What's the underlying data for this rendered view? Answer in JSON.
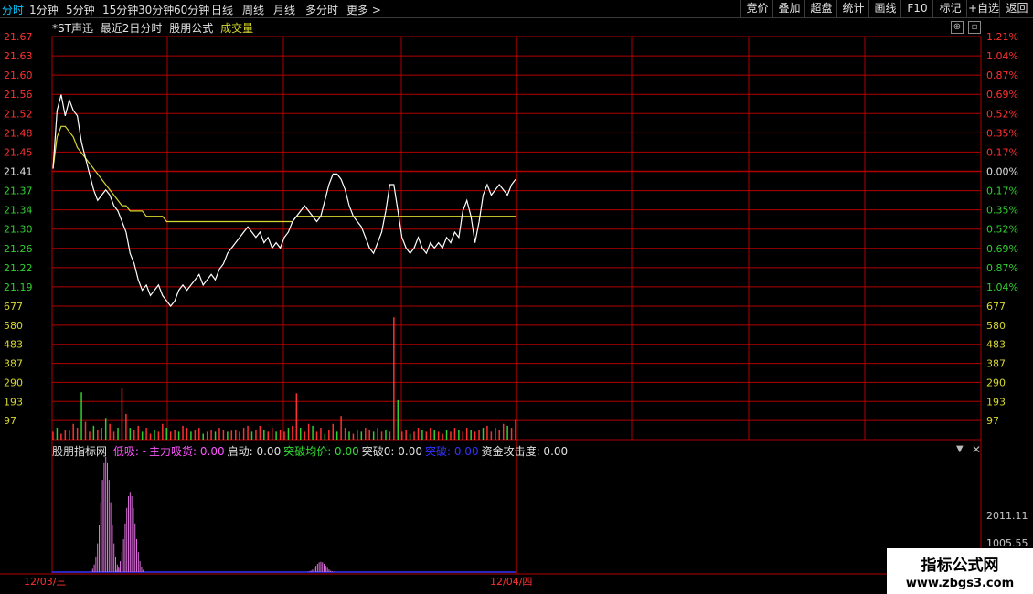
{
  "toolbar": {
    "tabs": [
      "分时",
      "1分钟",
      "5分钟",
      "15分钟",
      "30分钟",
      "60分钟",
      "日线",
      "周线",
      "月线",
      "多分时",
      "更多 >"
    ],
    "active_tab": "分时",
    "right_buttons": [
      "竞价",
      "叠加",
      "超盘",
      "统计",
      "画线",
      "F10",
      "标记",
      "+自选",
      "返回"
    ]
  },
  "info_bar": {
    "stock": "*ST声迅",
    "mode": "最近2日分时",
    "formula": "股朋公式",
    "volume_label": "成交量"
  },
  "price_axis": {
    "left": [
      "21.67",
      "21.63",
      "21.60",
      "21.56",
      "21.52",
      "21.48",
      "21.45",
      "21.41",
      "21.37",
      "21.34",
      "21.30",
      "21.26",
      "21.22",
      "21.19"
    ],
    "right": [
      "1.21%",
      "1.04%",
      "0.87%",
      "0.69%",
      "0.52%",
      "0.35%",
      "0.17%",
      "0.00%",
      "0.17%",
      "0.35%",
      "0.52%",
      "0.69%",
      "0.87%",
      "1.04%"
    ]
  },
  "volume_axis": {
    "left": [
      "677",
      "580",
      "483",
      "387",
      "290",
      "193",
      "97"
    ],
    "right": [
      "677",
      "580",
      "483",
      "387",
      "290",
      "193",
      "97"
    ]
  },
  "indicator_bar": {
    "name": "股朋指标网",
    "items": [
      {
        "text": "低吸: -",
        "color": "#ff55ff"
      },
      {
        "text": "主力吸货: 0.00",
        "color": "#ff55ff"
      },
      {
        "text": "启动: 0.00",
        "color": "#e0e0e0"
      },
      {
        "text": "突破均价: 0.00",
        "color": "#33dd33"
      },
      {
        "text": "突破0: 0.00",
        "color": "#e0e0e0"
      },
      {
        "text": "突破: 0.00",
        "color": "#3333ff"
      },
      {
        "text": "资金攻击度: 0.00",
        "color": "#e0e0e0"
      }
    ]
  },
  "indicator_axis": [
    "2011.11",
    "1005.55"
  ],
  "dates": [
    "12/03/三",
    "12/04/四"
  ],
  "watermark": {
    "line1": "指标公式网",
    "line2": "www.zbgs3.com"
  },
  "colors": {
    "grid": "#b00000",
    "price_line": "#ffffff",
    "avg_line": "#d8d830",
    "up": "#ff3030",
    "down": "#30d030",
    "flat": "#c8c8c8",
    "indicator": "#e070e0"
  },
  "chart_data": {
    "type": "line",
    "price_series": {
      "prev_close": 21.41,
      "ylim": [
        21.17,
        21.68
      ],
      "price": [
        21.43,
        21.54,
        21.57,
        21.53,
        21.56,
        21.54,
        21.53,
        21.48,
        21.45,
        21.42,
        21.39,
        21.37,
        21.38,
        21.39,
        21.38,
        21.36,
        21.35,
        21.33,
        21.31,
        21.27,
        21.25,
        21.22,
        21.2,
        21.21,
        21.19,
        21.2,
        21.21,
        21.19,
        21.18,
        21.17,
        21.18,
        21.2,
        21.21,
        21.2,
        21.21,
        21.22,
        21.23,
        21.21,
        21.22,
        21.23,
        21.22,
        21.24,
        21.25,
        21.27,
        21.28,
        21.29,
        21.3,
        21.31,
        21.32,
        21.31,
        21.3,
        21.31,
        21.29,
        21.3,
        21.28,
        21.29,
        21.28,
        21.3,
        21.31,
        21.33,
        21.34,
        21.35,
        21.36,
        21.35,
        21.34,
        21.33,
        21.34,
        21.37,
        21.4,
        21.42,
        21.42,
        21.41,
        21.39,
        21.36,
        21.34,
        21.33,
        21.32,
        21.3,
        21.28,
        21.27,
        21.29,
        21.31,
        21.35,
        21.4,
        21.4,
        21.35,
        21.3,
        21.28,
        21.27,
        21.28,
        21.3,
        21.28,
        21.27,
        21.29,
        21.28,
        21.29,
        21.28,
        21.3,
        21.29,
        21.31,
        21.3,
        21.35,
        21.37,
        21.34,
        21.29,
        21.33,
        21.38,
        21.4,
        21.38,
        21.39,
        21.4,
        21.39,
        21.38,
        21.4,
        21.41
      ],
      "avg": [
        21.43,
        21.49,
        21.51,
        21.51,
        21.5,
        21.49,
        21.47,
        21.46,
        21.45,
        21.44,
        21.43,
        21.42,
        21.41,
        21.4,
        21.39,
        21.38,
        21.37,
        21.36,
        21.36,
        21.35,
        21.35,
        21.35,
        21.35,
        21.34,
        21.34,
        21.34,
        21.34,
        21.34,
        21.33,
        21.33,
        21.33,
        21.33,
        21.33,
        21.33,
        21.33,
        21.33,
        21.33,
        21.33,
        21.33,
        21.33,
        21.33,
        21.33,
        21.33,
        21.33,
        21.33,
        21.33,
        21.33,
        21.33,
        21.33,
        21.33,
        21.33,
        21.33,
        21.33,
        21.33,
        21.33,
        21.33,
        21.33,
        21.33,
        21.33,
        21.33,
        21.34,
        21.34,
        21.34,
        21.34,
        21.34,
        21.34,
        21.34,
        21.34,
        21.34,
        21.34,
        21.34,
        21.34,
        21.34,
        21.34,
        21.34,
        21.34,
        21.34,
        21.34,
        21.34,
        21.34,
        21.34,
        21.34,
        21.34,
        21.34,
        21.34,
        21.34,
        21.34,
        21.34,
        21.34,
        21.34,
        21.34,
        21.34,
        21.34,
        21.34,
        21.34,
        21.34,
        21.34,
        21.34,
        21.34,
        21.34,
        21.34,
        21.34,
        21.34,
        21.34,
        21.34,
        21.34,
        21.34,
        21.34,
        21.34,
        21.34,
        21.34,
        21.34,
        21.34,
        21.34,
        21.34
      ]
    },
    "volume_series": {
      "ylim": [
        0,
        677
      ],
      "values": [
        40,
        60,
        30,
        50,
        45,
        80,
        60,
        240,
        90,
        40,
        70,
        50,
        60,
        110,
        80,
        40,
        60,
        260,
        130,
        60,
        50,
        70,
        40,
        60,
        30,
        50,
        40,
        80,
        60,
        40,
        50,
        40,
        70,
        60,
        40,
        50,
        60,
        30,
        40,
        50,
        40,
        60,
        50,
        40,
        45,
        50,
        40,
        60,
        70,
        40,
        50,
        70,
        50,
        40,
        60,
        40,
        50,
        40,
        60,
        70,
        235,
        60,
        40,
        80,
        70,
        40,
        60,
        30,
        50,
        80,
        40,
        120,
        60,
        40,
        30,
        50,
        40,
        60,
        50,
        40,
        60,
        40,
        50,
        40,
        620,
        200,
        40,
        50,
        30,
        40,
        60,
        50,
        40,
        60,
        50,
        40,
        30,
        50,
        40,
        60,
        50,
        40,
        60,
        50,
        40,
        50,
        60,
        70,
        40,
        60,
        50,
        80,
        70,
        60,
        100
      ],
      "directions": "mixed up/down"
    },
    "indicator_series": {
      "ylim": [
        0,
        2011.11
      ],
      "peaks": [
        {
          "x_index": 13,
          "value": 2011
        },
        {
          "x_index": 19,
          "value": 1400
        },
        {
          "x_index": 66,
          "value": 180
        }
      ]
    },
    "xlabels": [
      "12/03/三",
      "12/04/四"
    ]
  }
}
